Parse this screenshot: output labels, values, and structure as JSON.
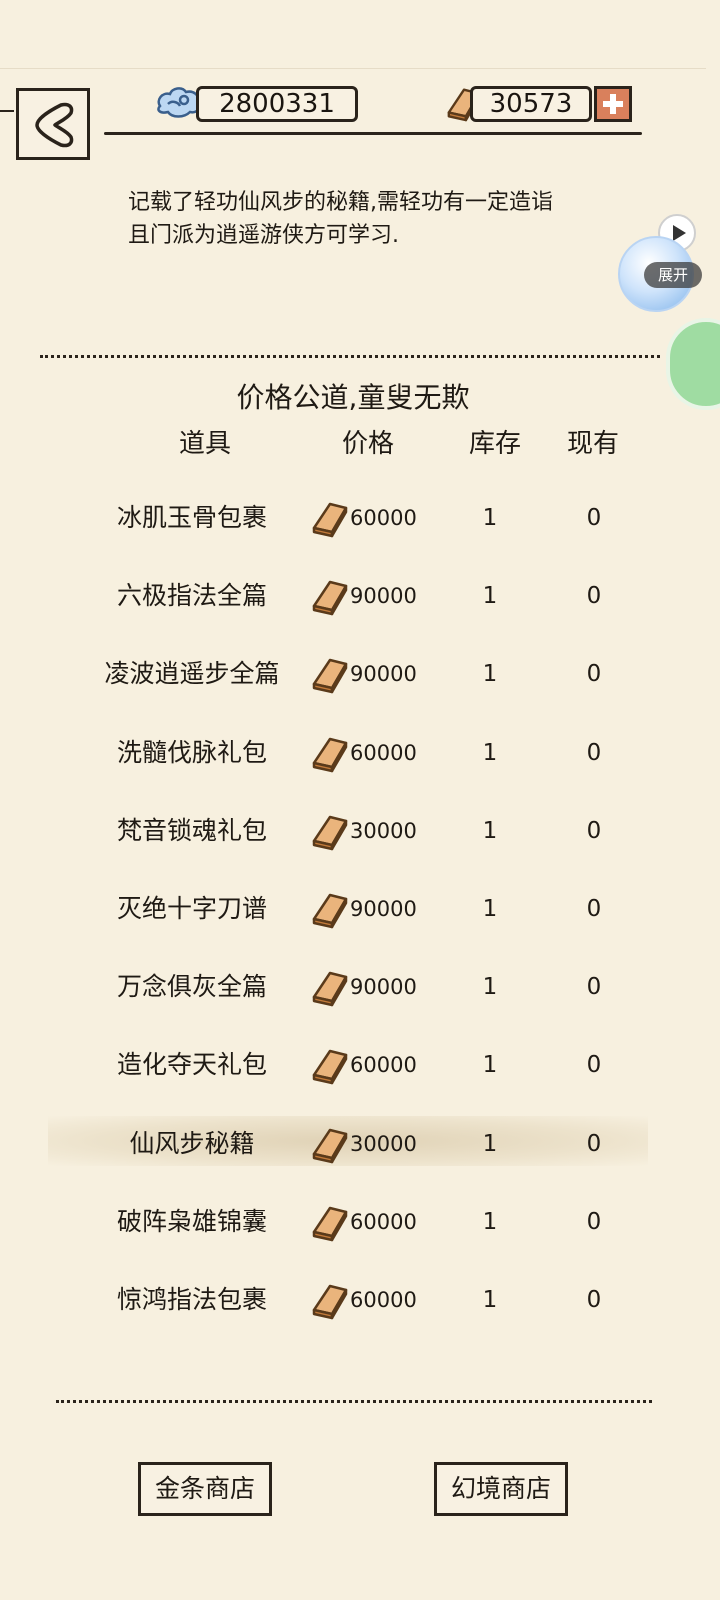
{
  "header": {
    "silver_amount": "2800331",
    "gold_amount": "30573"
  },
  "description": "记载了轻功仙风步的秘籍,需轻功有一定造诣且门派为逍遥游侠方可学习.",
  "side_widget": {
    "expand_label": "展开"
  },
  "shop": {
    "slogan": "价格公道,童叟无欺",
    "columns": {
      "item": "道具",
      "price": "价格",
      "stock": "库存",
      "owned": "现有"
    },
    "items": [
      {
        "name": "冰肌玉骨包裹",
        "price": "60000",
        "stock": "1",
        "owned": "0"
      },
      {
        "name": "六极指法全篇",
        "price": "90000",
        "stock": "1",
        "owned": "0"
      },
      {
        "name": "凌波逍遥步全篇",
        "price": "90000",
        "stock": "1",
        "owned": "0"
      },
      {
        "name": "洗髓伐脉礼包",
        "price": "60000",
        "stock": "1",
        "owned": "0"
      },
      {
        "name": "梵音锁魂礼包",
        "price": "30000",
        "stock": "1",
        "owned": "0"
      },
      {
        "name": "灭绝十字刀谱",
        "price": "90000",
        "stock": "1",
        "owned": "0"
      },
      {
        "name": "万念俱灰全篇",
        "price": "90000",
        "stock": "1",
        "owned": "0"
      },
      {
        "name": "造化夺天礼包",
        "price": "60000",
        "stock": "1",
        "owned": "0"
      },
      {
        "name": "仙风步秘籍",
        "price": "30000",
        "stock": "1",
        "owned": "0"
      },
      {
        "name": "破阵枭雄锦囊",
        "price": "60000",
        "stock": "1",
        "owned": "0"
      },
      {
        "name": "惊鸿指法包裹",
        "price": "60000",
        "stock": "1",
        "owned": "0"
      }
    ],
    "selected_index": 8
  },
  "footer": {
    "gold_shop_label": "金条商店",
    "dream_shop_label": "幻境商店"
  },
  "colors": {
    "background": "#f7f0df",
    "ink": "#2a231b",
    "ingot": "#e3a468",
    "plus_button": "#d9805c",
    "highlight": "#d8c8a8"
  },
  "icons": {
    "back": "back-arrow-icon",
    "silver": "silver-cloud-icon",
    "gold": "gold-ingot-icon",
    "add": "plus-icon"
  }
}
